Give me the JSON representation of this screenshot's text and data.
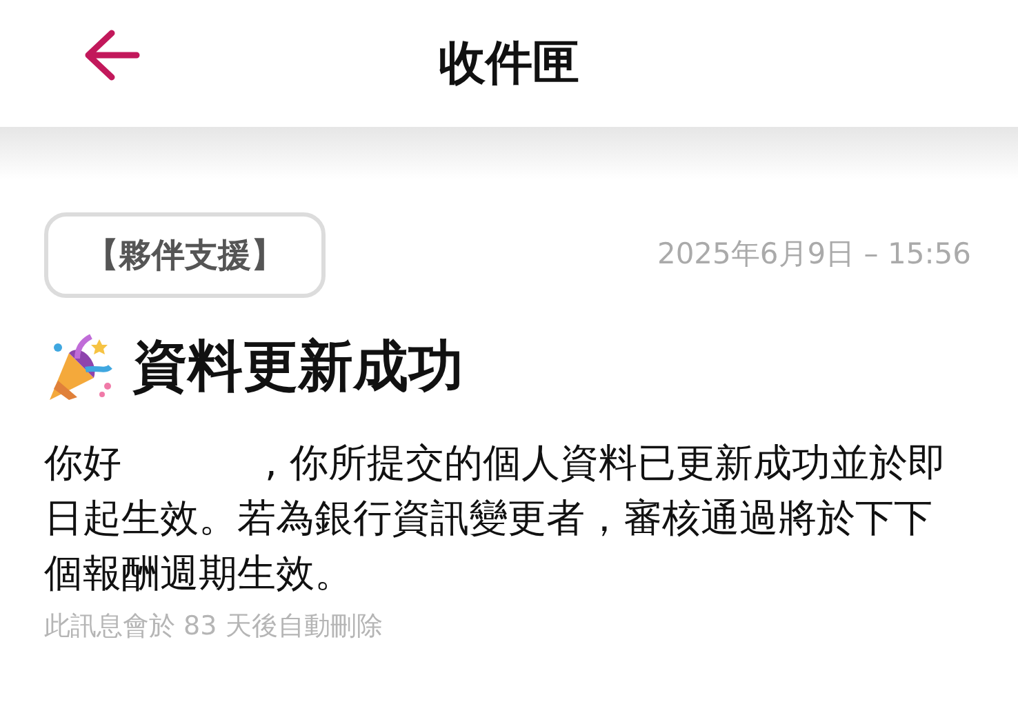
{
  "header": {
    "title": "收件匣"
  },
  "message": {
    "tag": "【夥伴支援】",
    "date": "2025年6月9日 – 15:56",
    "title": "資料更新成功",
    "greeting": "你好",
    "body": ", 你所提交的個人資料已更新成功並於即日起生效。若為銀行資訊變更者，審核通過將於下下個報酬週期生效。",
    "note": "此訊息會於 83 天後自動刪除"
  }
}
